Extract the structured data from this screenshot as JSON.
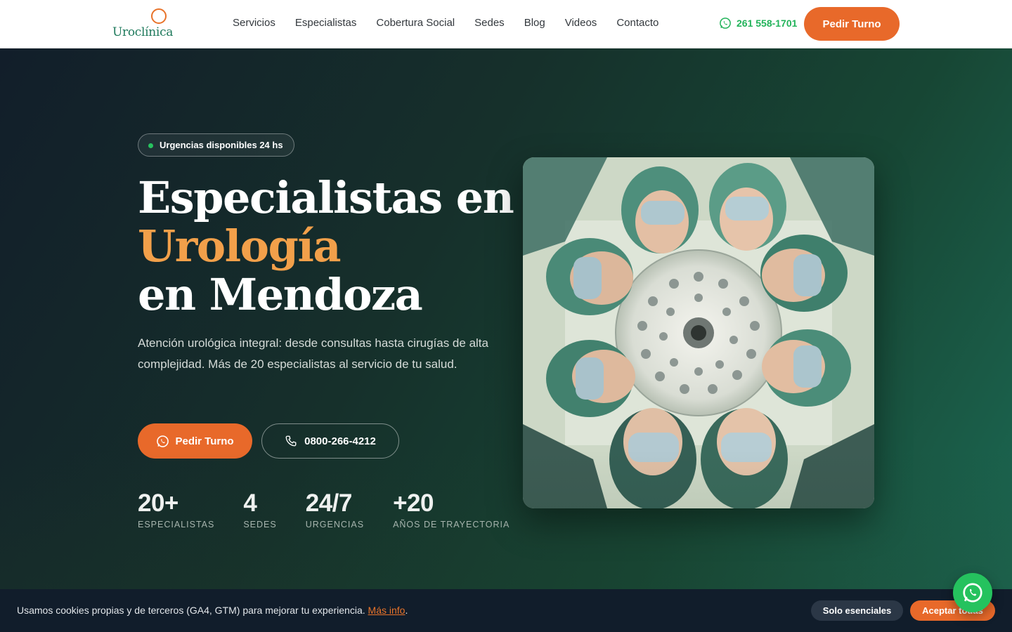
{
  "header": {
    "logo_text": "Uroclínica",
    "nav": [
      "Servicios",
      "Especialistas",
      "Cobertura Social",
      "Sedes",
      "Blog",
      "Videos",
      "Contacto"
    ],
    "phone": "261 558-1701",
    "cta": "Pedir Turno"
  },
  "hero": {
    "badge": "Urgencias disponibles 24 hs",
    "title_line1": "Especialistas en",
    "title_accent": "Urología",
    "title_line3": "en Mendoza",
    "lead": "Atención urológica integral: desde consultas hasta cirugías de alta complejidad. Más de 20 especialistas al servicio de tu salud.",
    "primary_cta": "Pedir Turno",
    "secondary_cta": "0800-266-4212",
    "stats": [
      {
        "value": "20+",
        "label": "ESPECIALISTAS"
      },
      {
        "value": "4",
        "label": "SEDES"
      },
      {
        "value": "24/7",
        "label": "URGENCIAS"
      },
      {
        "value": "+20",
        "label": "AÑOS DE TRAYECTORIA"
      }
    ]
  },
  "cookie": {
    "text": "Usamos cookies propias y de terceros (GA4, GTM) para mejorar tu experiencia.",
    "link": "Más info",
    "after": ".",
    "essentials": "Solo esenciales",
    "accept": "Aceptar todas"
  },
  "icons": {
    "whatsapp": "whatsapp-icon",
    "phone": "phone-icon"
  },
  "colors": {
    "brand_orange": "#e8692a",
    "brand_green": "#1f7a5c",
    "whatsapp_green": "#25c25e",
    "hero_accent": "#f2a04a"
  }
}
